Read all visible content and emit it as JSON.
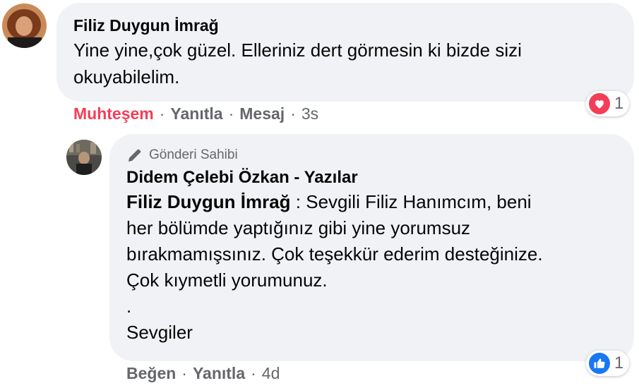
{
  "comment1": {
    "author": "Filiz Duygun İmrağ",
    "text_line1": "Yine yine,çok güzel. Elleriniz dert görmesin ki bizde sizi",
    "text_line2": "okuyabilelim.",
    "actions": {
      "reaction_label": "Muhteşem",
      "reply": "Yanıtla",
      "message": "Mesaj",
      "time": "3s"
    },
    "reaction": {
      "icon": "heart-icon",
      "count": "1",
      "color": "#f33e58"
    }
  },
  "comment2": {
    "badge": "Gönderi Sahibi",
    "badge_icon": "pencil-icon",
    "author": "Didem Çelebi Özkan - Yazılar",
    "mention": "Filiz Duygun İmrağ",
    "lines": [
      " : Sevgili Filiz Hanımcım, beni",
      "her bölümde yaptığınız gibi yine yorumsuz",
      "bırakmamışsınız. Çok teşekkür ederim desteğinize.",
      "Çok kıymetli yorumunuz.",
      ".",
      "Sevgiler"
    ],
    "actions": {
      "like": "Beğen",
      "reply": "Yanıtla",
      "time": "4d"
    },
    "reaction": {
      "icon": "thumbs-up-icon",
      "count": "1",
      "color": "#1877f2"
    }
  },
  "separator": "·"
}
